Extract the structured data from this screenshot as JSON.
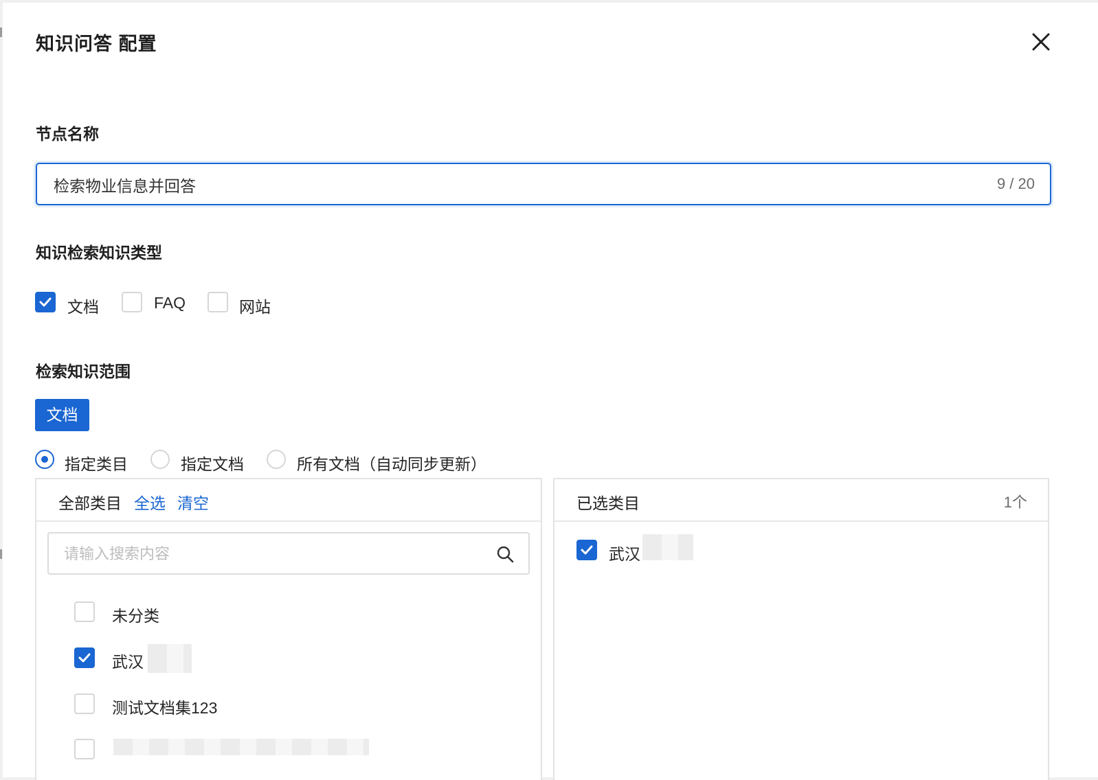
{
  "dialog": {
    "title": "知识问答 配置",
    "close_icon": "close-icon"
  },
  "node_name": {
    "label": "节点名称",
    "value": "检索物业信息并回答",
    "counter": "9 / 20"
  },
  "knowledge_types": {
    "label": "知识检索知识类型",
    "options": [
      {
        "label": "文档",
        "checked": true
      },
      {
        "label": "FAQ",
        "checked": false
      },
      {
        "label": "网站",
        "checked": false
      }
    ]
  },
  "scope": {
    "label": "检索知识范围",
    "tab_label": "文档",
    "radios": [
      {
        "label": "指定类目",
        "selected": true
      },
      {
        "label": "指定文档",
        "selected": false
      },
      {
        "label": "所有文档（自动同步更新）",
        "selected": false
      }
    ]
  },
  "all_categories": {
    "title": "全部类目",
    "select_all": "全选",
    "clear": "清空",
    "search_placeholder": "请输入搜索内容",
    "items": [
      {
        "label": "未分类",
        "checked": false
      },
      {
        "label": "武汉",
        "checked": true
      },
      {
        "label": "测试文档集123",
        "checked": false
      },
      {
        "label": "",
        "checked": false
      }
    ]
  },
  "selected_categories": {
    "title": "已选类目",
    "count": "1个",
    "items": [
      {
        "label": "武汉",
        "checked": true
      }
    ]
  },
  "colors": {
    "accent": "#1a66d2",
    "border": "#e3e3e3"
  }
}
